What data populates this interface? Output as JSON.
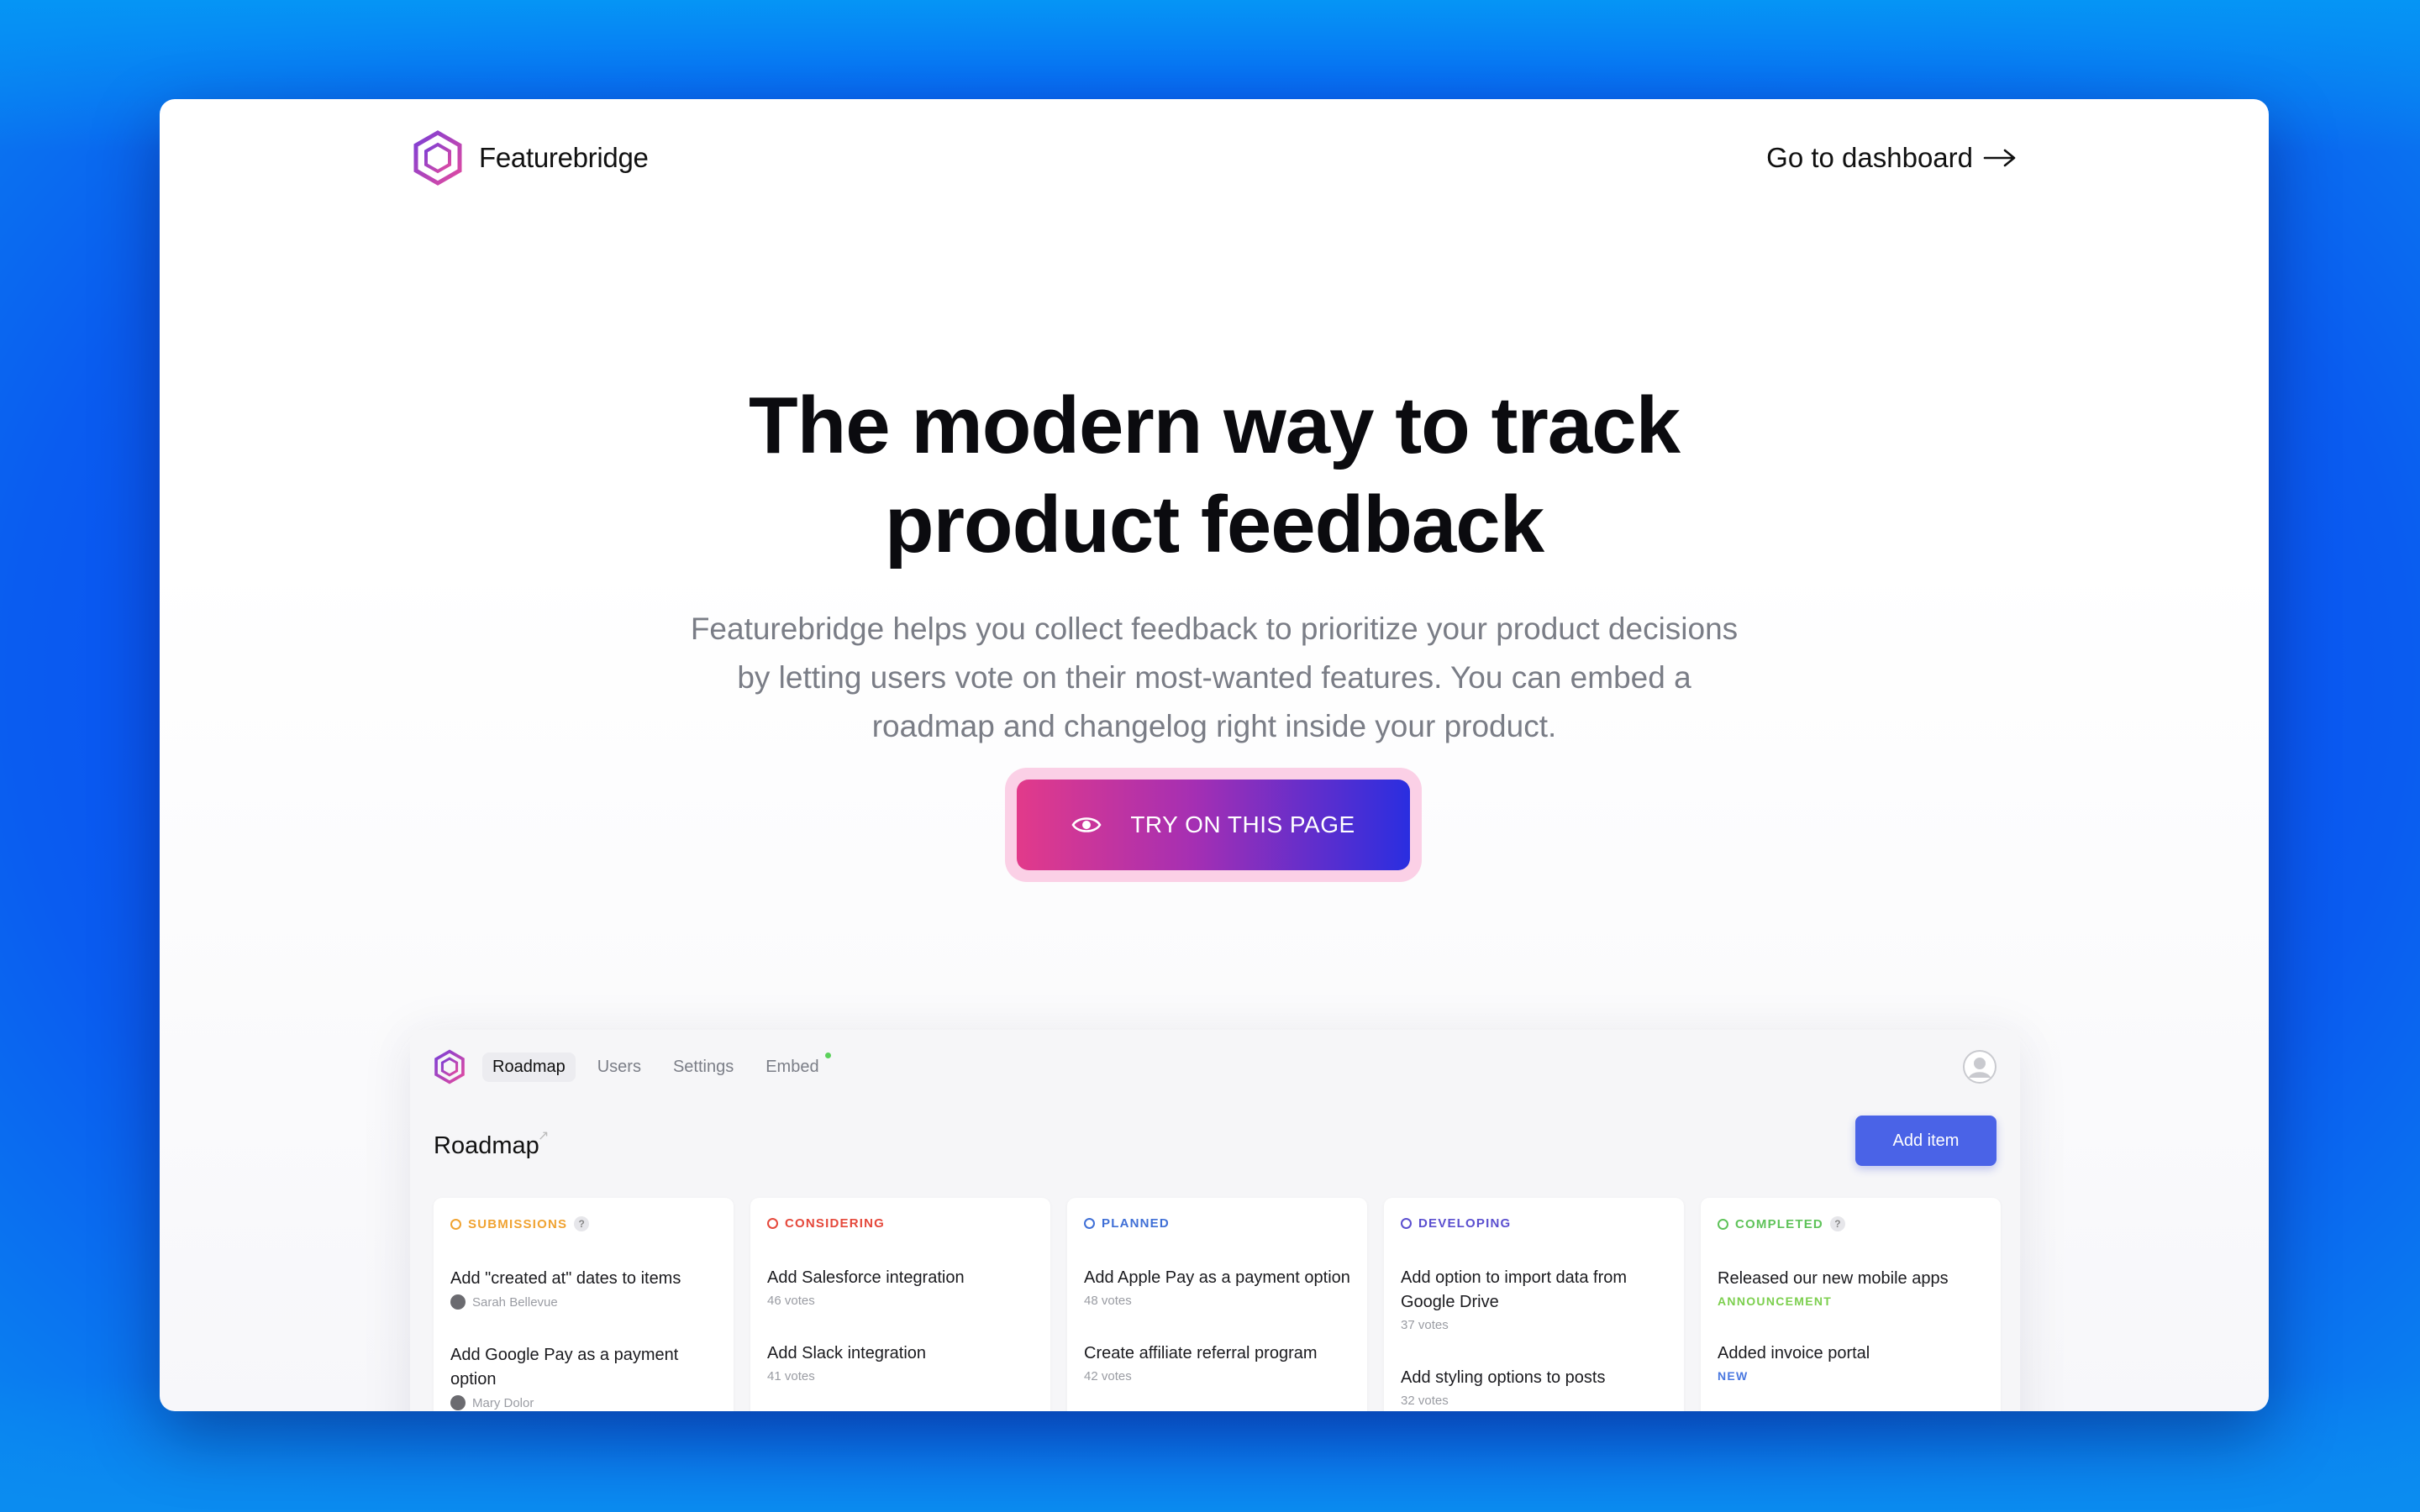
{
  "brand": {
    "name": "Featurebridge"
  },
  "header": {
    "dashboard_link": "Go to dashboard"
  },
  "hero": {
    "title_line1": "The modern way to track",
    "title_line2": "product feedback",
    "subtitle": "Featurebridge helps you collect feedback to prioritize your product decisions by letting users vote on their most-wanted features. You can embed a roadmap and changelog right inside your product.",
    "cta_label": "TRY ON THIS PAGE"
  },
  "app": {
    "tabs": [
      {
        "label": "Roadmap",
        "active": true
      },
      {
        "label": "Users",
        "active": false
      },
      {
        "label": "Settings",
        "active": false
      },
      {
        "label": "Embed",
        "active": false
      }
    ],
    "page_title": "Roadmap",
    "add_button": "Add item",
    "columns": [
      {
        "title": "SUBMISSIONS",
        "color": "#f0a332",
        "help": "?",
        "items": [
          {
            "title": "Add \"created at\" dates to items",
            "meta": "Sarah Bellevue"
          },
          {
            "title": "Add Google Pay as a payment option",
            "meta": "Mary Dolor"
          }
        ]
      },
      {
        "title": "CONSIDERING",
        "color": "#e5483b",
        "items": [
          {
            "title": "Add Salesforce integration",
            "meta": "46 votes"
          },
          {
            "title": "Add Slack integration",
            "meta": "41 votes"
          }
        ]
      },
      {
        "title": "PLANNED",
        "color": "#3f6fd6",
        "items": [
          {
            "title": "Add Apple Pay as a payment option",
            "meta": "48 votes"
          },
          {
            "title": "Create affiliate referral program",
            "meta": "42 votes"
          }
        ]
      },
      {
        "title": "DEVELOPING",
        "color": "#5b4fcf",
        "items": [
          {
            "title": "Add option to import data from Google Drive",
            "meta": "37 votes"
          },
          {
            "title": "Add styling options to posts",
            "meta": "32 votes"
          }
        ]
      },
      {
        "title": "COMPLETED",
        "color": "#5fc35a",
        "help": "?",
        "items": [
          {
            "title": "Released our new mobile apps",
            "tag": "ANNOUNCEMENT",
            "tag_color": "#7ccf4e"
          },
          {
            "title": "Added invoice portal",
            "tag": "NEW",
            "tag_color": "#4a78e0"
          }
        ]
      }
    ]
  }
}
